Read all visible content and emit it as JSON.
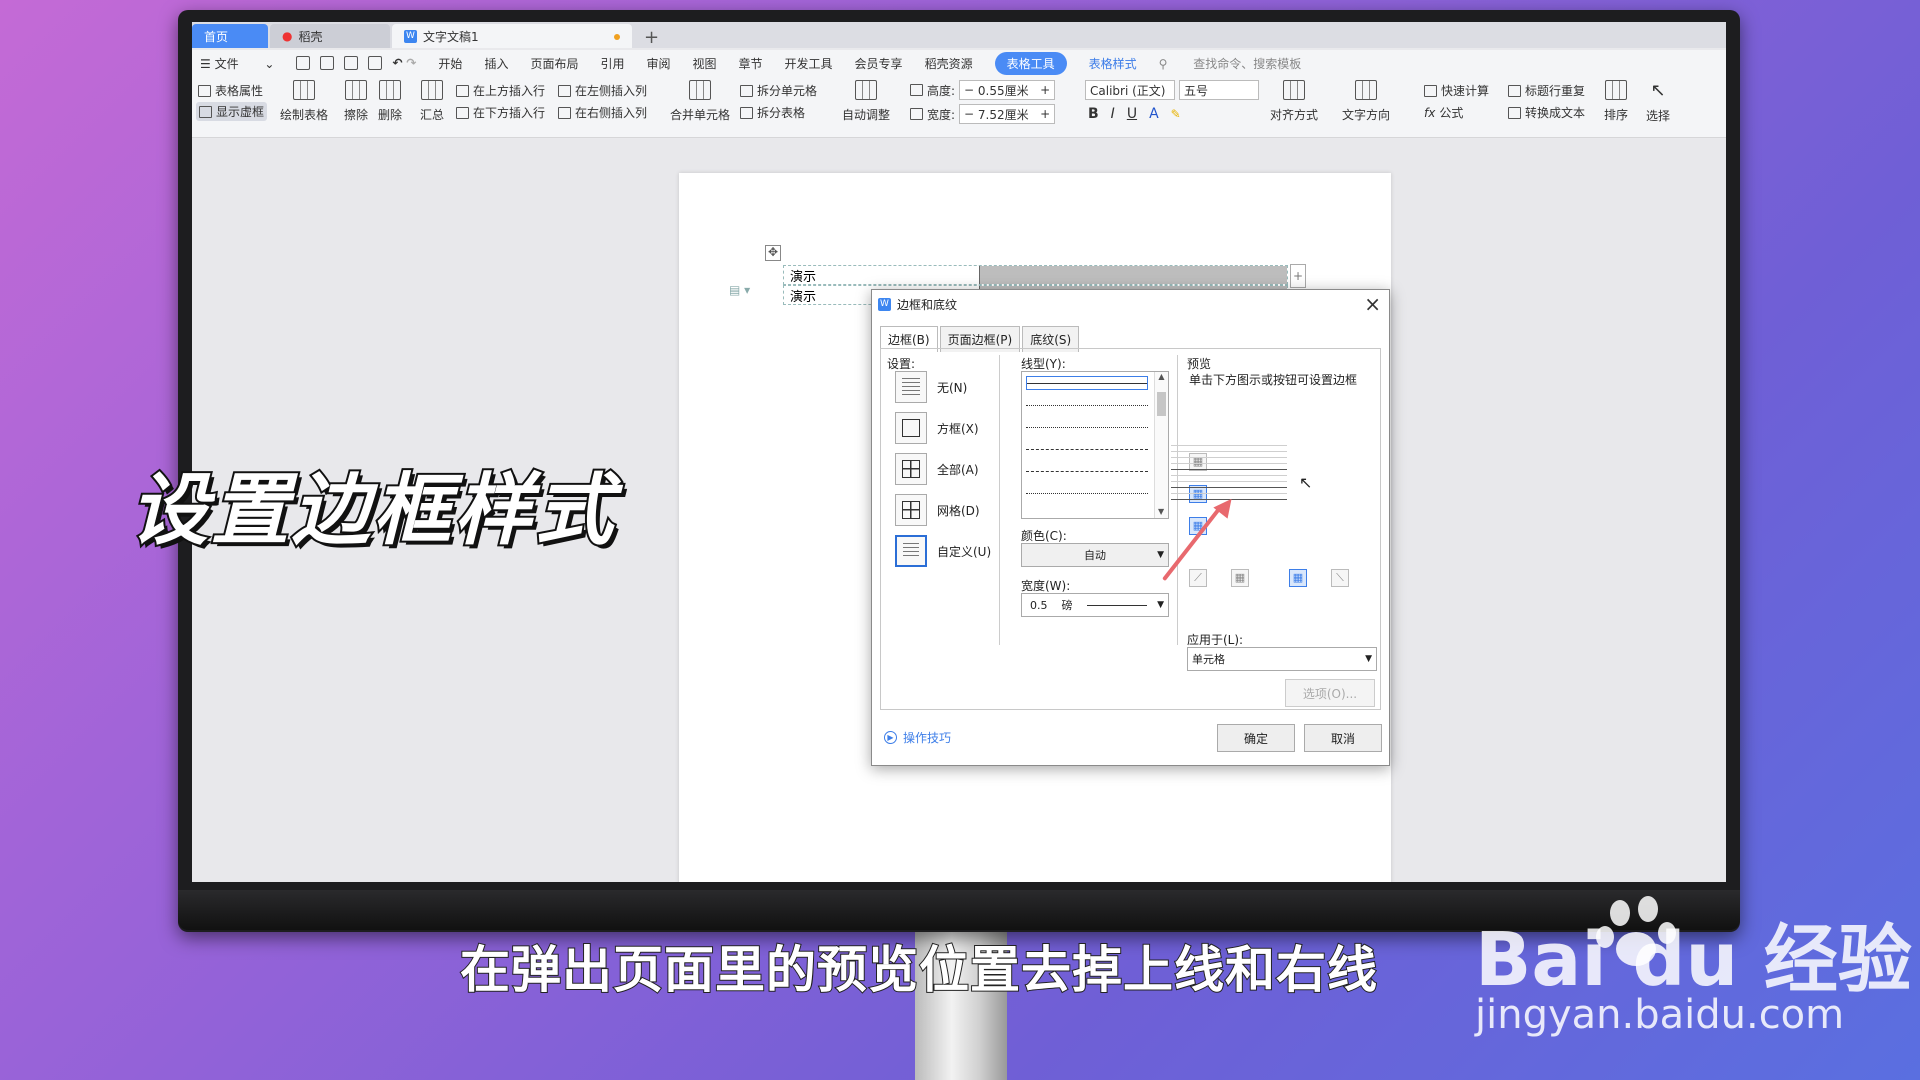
{
  "tabs": {
    "home": "首页",
    "daoke": "稻壳",
    "doc": "文字文稿1"
  },
  "menu": {
    "file": "文件",
    "items": [
      "开始",
      "插入",
      "页面布局",
      "引用",
      "审阅",
      "视图",
      "章节",
      "开发工具",
      "会员专享",
      "稻壳资源"
    ],
    "table_tool": "表格工具",
    "table_style": "表格样式",
    "search": "查找命令、搜索模板"
  },
  "ribbon": {
    "table_props": "表格属性",
    "show_grid": "显示虚框",
    "draw_table": "绘制表格",
    "erase": "擦除",
    "delete": "删除",
    "summary": "汇总",
    "insert_above": "在上方插入行",
    "insert_below": "在下方插入行",
    "insert_left": "在左侧插入列",
    "insert_right": "在右侧插入列",
    "merge": "合并单元格",
    "split_cell": "拆分单元格",
    "split_table": "拆分表格",
    "auto_fit": "自动调整",
    "height_label": "高度:",
    "height_value": "0.55厘米",
    "width_label": "宽度:",
    "width_value": "7.52厘米",
    "font": "Calibri (正文)",
    "font_size": "五号",
    "align": "对齐方式",
    "text_dir": "文字方向",
    "quick_calc": "快速计算",
    "title_repeat": "标题行重复",
    "formula": "公式",
    "to_text": "转换成文本",
    "sort": "排序",
    "select": "选择"
  },
  "document": {
    "row1": "演示",
    "row2": "演示"
  },
  "dialog": {
    "title": "边框和底纹",
    "tabs": [
      "边框(B)",
      "页面边框(P)",
      "底纹(S)"
    ],
    "setting_label": "设置:",
    "settings": [
      "无(N)",
      "方框(X)",
      "全部(A)",
      "网格(D)",
      "自定义(U)"
    ],
    "line_style_label": "线型(Y):",
    "color_label": "颜色(C):",
    "color_value": "自动",
    "width_label": "宽度(W):",
    "width_value": "0.5",
    "width_unit": "磅",
    "preview_label": "预览",
    "preview_hint": "单击下方图示或按钮可设置边框",
    "apply_label": "应用于(L):",
    "apply_value": "单元格",
    "options_btn": "选项(O)...",
    "tips": "操作技巧",
    "ok": "确定",
    "cancel": "取消"
  },
  "overlay": {
    "title": "设置边框样式",
    "subtitle": "在弹出页面里的预览位置去掉上线和右线"
  },
  "watermark": {
    "brand": "Bai du 经验",
    "url": "jingyan.baidu.com"
  },
  "colors": {
    "accent": "#4a8bf5",
    "arrow": "#e8696e"
  }
}
